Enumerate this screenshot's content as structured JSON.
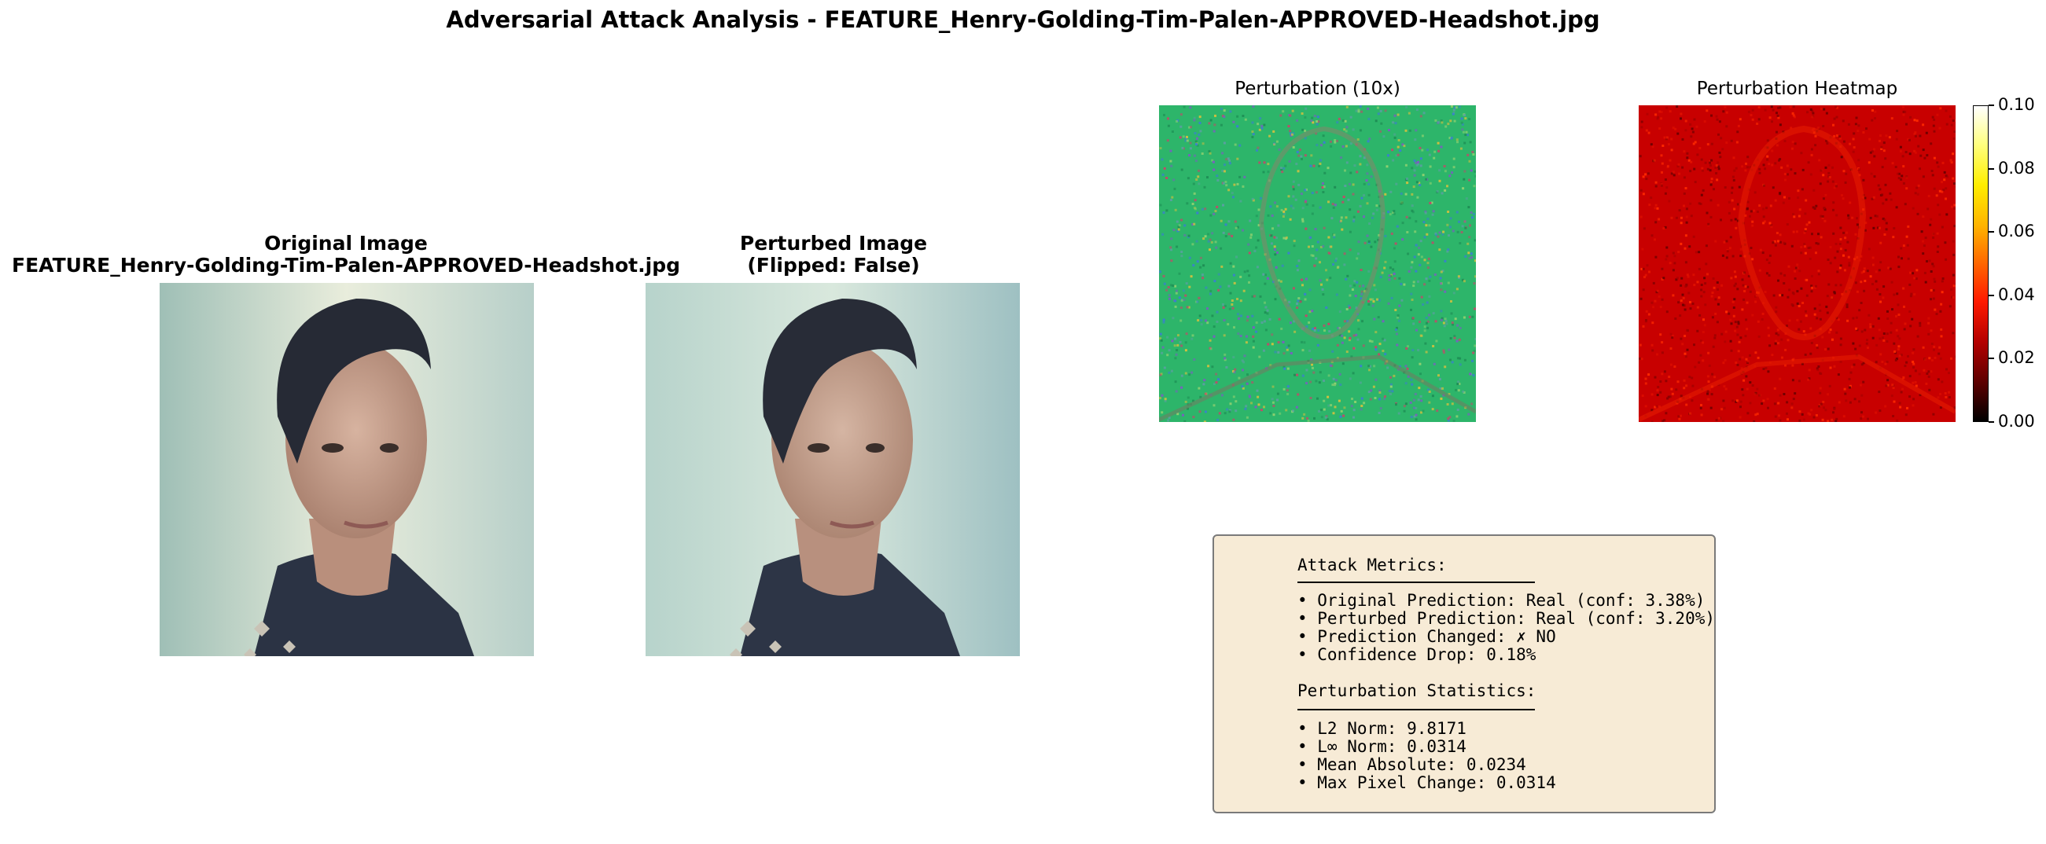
{
  "figure": {
    "title": "Adversarial Attack Analysis - FEATURE_Henry-Golding-Tim-Palen-APPROVED-Headshot.jpg"
  },
  "panels": {
    "original": {
      "title_line1": "Original Image",
      "title_line2": "FEATURE_Henry-Golding-Tim-Palen-APPROVED-Headshot.jpg"
    },
    "perturbed": {
      "title_line1": "Perturbed Image",
      "title_line2": "(Flipped: False)"
    },
    "perturbation": {
      "title": "Perturbation (10x)"
    },
    "heatmap": {
      "title": "Perturbation Heatmap"
    }
  },
  "chart_data": {
    "type": "heatmap",
    "title": "Perturbation Heatmap",
    "colormap": "hot",
    "colorbar": {
      "min": 0.0,
      "max": 0.1,
      "ticks": [
        "0.00",
        "0.02",
        "0.04",
        "0.06",
        "0.08",
        "0.10"
      ]
    }
  },
  "metrics": {
    "heading": "Attack Metrics:",
    "lines": [
      "• Original Prediction: Real (conf: 3.38%)",
      "• Perturbed Prediction: Real (conf: 3.20%)",
      "• Prediction Changed: ✗ NO",
      "• Confidence Drop: 0.18%"
    ],
    "stats_heading": "Perturbation Statistics:",
    "stats_lines": [
      "• L2 Norm: 9.8171",
      "• L∞ Norm: 0.0314",
      "• Mean Absolute: 0.0234",
      "• Max Pixel Change: 0.0314"
    ]
  },
  "colors": {
    "metrics_box_bg": "#f7ebd6",
    "perturbation_base": "#2db56a",
    "heatmap_base": "#c80000"
  }
}
